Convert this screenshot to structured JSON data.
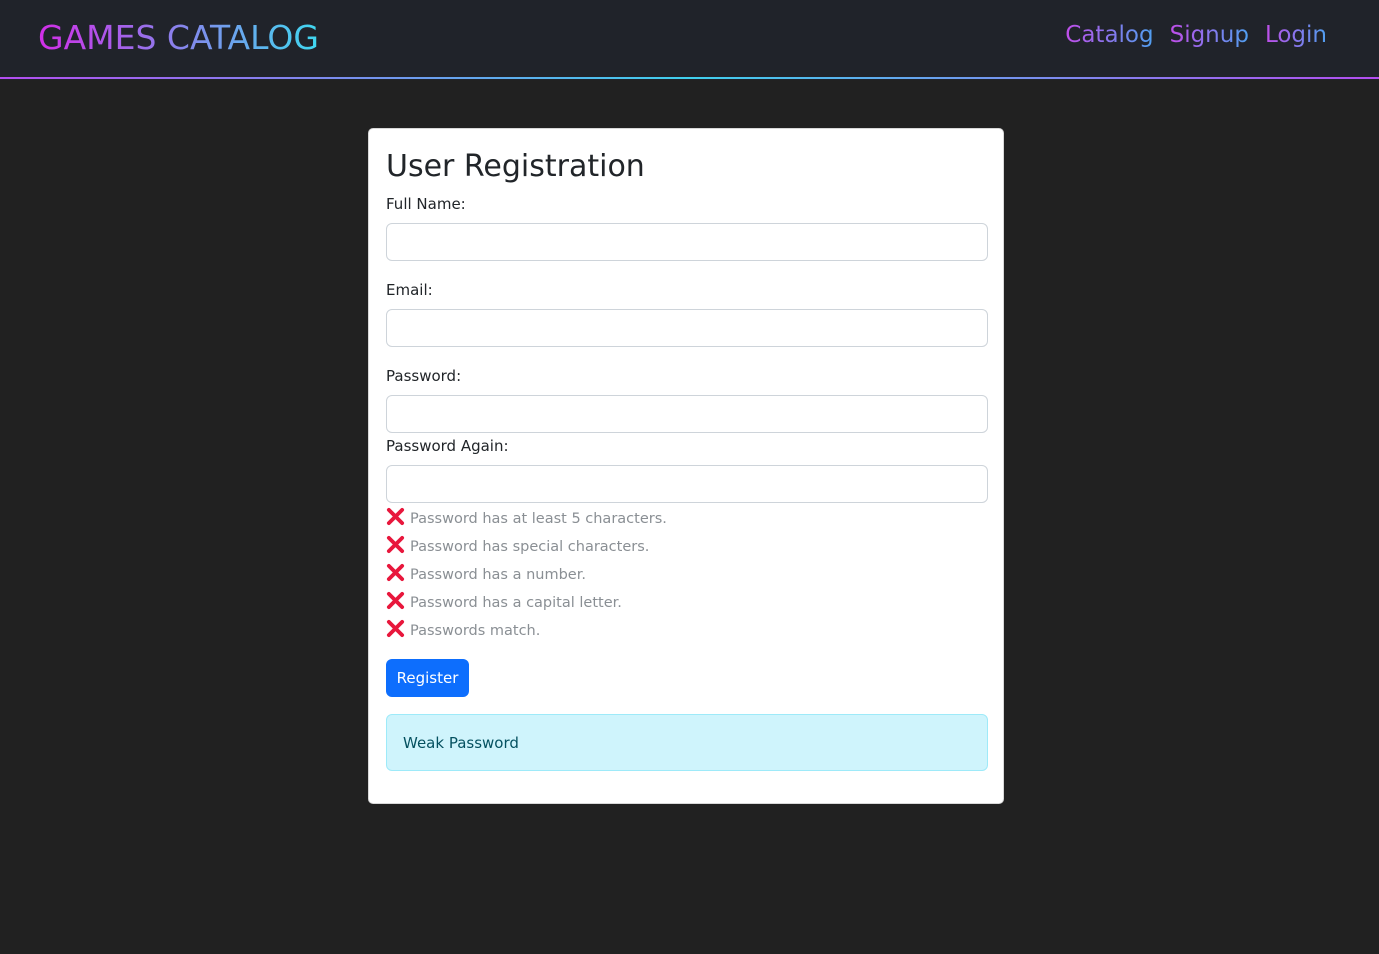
{
  "navbar": {
    "brand": "GAMES CATALOG",
    "links": [
      {
        "label": "Catalog"
      },
      {
        "label": "Signup"
      },
      {
        "label": "Login"
      }
    ]
  },
  "form": {
    "title": "User Registration",
    "fields": {
      "full_name": {
        "label": "Full Name:",
        "value": "",
        "placeholder": ""
      },
      "email": {
        "label": "Email:",
        "value": "",
        "placeholder": ""
      },
      "password": {
        "label": "Password:",
        "value": "",
        "placeholder": ""
      },
      "password_again": {
        "label": "Password Again:",
        "value": "",
        "placeholder": ""
      }
    },
    "requirements": [
      {
        "text": "Password has at least 5 characters.",
        "met": false,
        "icon": "x-icon"
      },
      {
        "text": "Password has special characters.",
        "met": false,
        "icon": "x-icon"
      },
      {
        "text": "Password has a number.",
        "met": false,
        "icon": "x-icon"
      },
      {
        "text": "Password has a capital letter.",
        "met": false,
        "icon": "x-icon"
      },
      {
        "text": "Passwords match.",
        "met": false,
        "icon": "x-icon"
      }
    ],
    "register_label": "Register",
    "strength_message": "Weak Password"
  },
  "colors": {
    "background": "#212121",
    "navbar": "#20232a",
    "accent_purple": "#c04de9",
    "accent_cyan": "#3fd8f0",
    "button": "#0d6efd",
    "alert_bg": "#cff4fc",
    "error_x": "#e8173c"
  }
}
